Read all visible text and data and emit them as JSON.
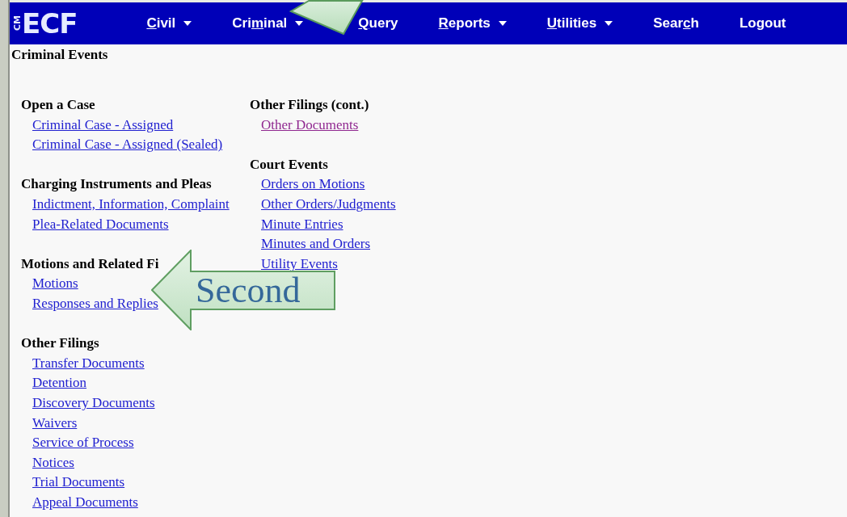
{
  "navbar": {
    "logo": {
      "small": "CM",
      "large": "ECF"
    },
    "items": [
      {
        "key": "C",
        "after": "ivil",
        "dropdown": true
      },
      {
        "before": "Cri",
        "key": "m",
        "after": "inal",
        "dropdown": true
      },
      {
        "key": "Q",
        "after": "uery",
        "dropdown": false
      },
      {
        "key": "R",
        "after": "eports",
        "dropdown": true
      },
      {
        "key": "U",
        "after": "tilities",
        "dropdown": true
      },
      {
        "before": "Sear",
        "key": "c",
        "after": "h",
        "dropdown": false
      },
      {
        "before": "Logout",
        "dropdown": false
      }
    ]
  },
  "page_title": "Criminal Events",
  "columns": [
    [
      {
        "heading": "Open a Case",
        "links": [
          {
            "label": "Criminal Case - Assigned",
            "visited": false
          },
          {
            "label": "Criminal Case - Assigned (Sealed)",
            "visited": false
          }
        ]
      },
      {
        "heading": "Charging Instruments and Pleas",
        "links": [
          {
            "label": "Indictment, Information, Complaint",
            "visited": false
          },
          {
            "label": "Plea-Related Documents",
            "visited": false
          }
        ]
      },
      {
        "heading": "Motions and Related Fi",
        "links": [
          {
            "label": "Motions",
            "visited": false
          },
          {
            "label": "Responses and Replies",
            "visited": false
          }
        ]
      },
      {
        "heading": "Other Filings",
        "links": [
          {
            "label": "Transfer Documents",
            "visited": false
          },
          {
            "label": "Detention",
            "visited": false
          },
          {
            "label": "Discovery Documents",
            "visited": false
          },
          {
            "label": "Waivers",
            "visited": false
          },
          {
            "label": "Service of Process",
            "visited": false
          },
          {
            "label": "Notices",
            "visited": false
          },
          {
            "label": "Trial Documents",
            "visited": false
          },
          {
            "label": "Appeal Documents",
            "visited": false
          }
        ]
      }
    ],
    [
      {
        "heading": "Other Filings (cont.)",
        "links": [
          {
            "label": "Other Documents",
            "visited": true
          }
        ]
      },
      {
        "heading": "Court Events",
        "links": [
          {
            "label": "Orders on Motions",
            "visited": false
          },
          {
            "label": "Other Orders/Judgments",
            "visited": false
          },
          {
            "label": "Minute Entries",
            "visited": false
          },
          {
            "label": "Minutes and Orders",
            "visited": false
          },
          {
            "label": "Utility Events",
            "visited": false
          }
        ]
      }
    ]
  ],
  "callouts": [
    {
      "kind": "top"
    },
    {
      "kind": "left",
      "label": "Second"
    }
  ]
}
